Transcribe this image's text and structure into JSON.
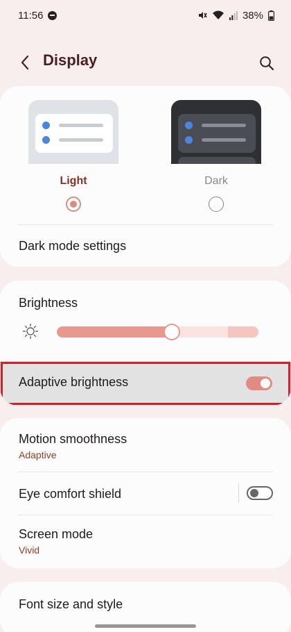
{
  "status_bar": {
    "time": "11:56",
    "battery": "38%"
  },
  "header": {
    "title": "Display"
  },
  "theme": {
    "light_label": "Light",
    "dark_label": "Dark",
    "selected": "Light",
    "dark_mode_settings": "Dark mode settings"
  },
  "brightness": {
    "title": "Brightness",
    "level_fraction": 0.57,
    "adaptive_label": "Adaptive brightness",
    "adaptive_on": true
  },
  "motion": {
    "title": "Motion smoothness",
    "value": "Adaptive"
  },
  "eye_comfort": {
    "title": "Eye comfort shield",
    "on": false
  },
  "screen_mode": {
    "title": "Screen mode",
    "value": "Vivid"
  },
  "font": {
    "title": "Font size and style"
  },
  "colors": {
    "accent": "#e08c82",
    "accent_text": "#9a3a2a",
    "highlight_border": "#d4202c"
  }
}
